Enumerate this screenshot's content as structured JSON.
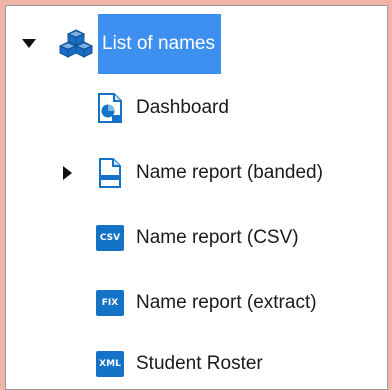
{
  "tree": {
    "root": {
      "label": "List of names",
      "icon": "cubes-icon",
      "expanded": true,
      "selected": true
    },
    "items": [
      {
        "label": "Dashboard",
        "icon": "dashboard-icon",
        "has_children": false
      },
      {
        "label": "Name report (banded)",
        "icon": "document-icon",
        "has_children": true,
        "expanded": false
      },
      {
        "label": "Name report (CSV)",
        "icon": "csv-icon",
        "badge": "CSV",
        "has_children": false
      },
      {
        "label": "Name report (extract)",
        "icon": "fix-icon",
        "badge": "FIX",
        "has_children": false
      },
      {
        "label": "Student Roster",
        "icon": "xml-icon",
        "badge": "XML",
        "has_children": false
      }
    ]
  },
  "colors": {
    "background": "#f0b3a6",
    "selection": "#3d8ff0",
    "icon_blue": "#1573c7"
  }
}
